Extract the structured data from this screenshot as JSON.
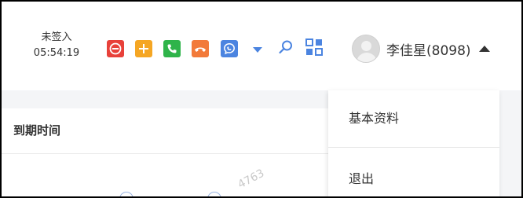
{
  "header": {
    "signin_status": "未签入",
    "signin_time": "05:54:19"
  },
  "toolbar": {
    "tools": [
      {
        "name": "dnd-icon",
        "color": "#e8413a"
      },
      {
        "name": "add-icon",
        "color": "#f5a623"
      },
      {
        "name": "phone-answer-icon",
        "color": "#2fb44a"
      },
      {
        "name": "phone-hangup-icon",
        "color": "#f27a3a"
      },
      {
        "name": "chat-icon",
        "color": "#4b84e0"
      }
    ],
    "more_icon": "chevron-down-icon",
    "search_icon": "search-icon",
    "apps_icon": "grid-icon",
    "accent": "#4b84e0"
  },
  "user": {
    "name": "李佳星(8098)"
  },
  "table": {
    "column_header": "到期时间",
    "watermark": "4763"
  },
  "user_menu": {
    "items": [
      {
        "label": "基本资料"
      },
      {
        "label": "退出"
      }
    ]
  }
}
